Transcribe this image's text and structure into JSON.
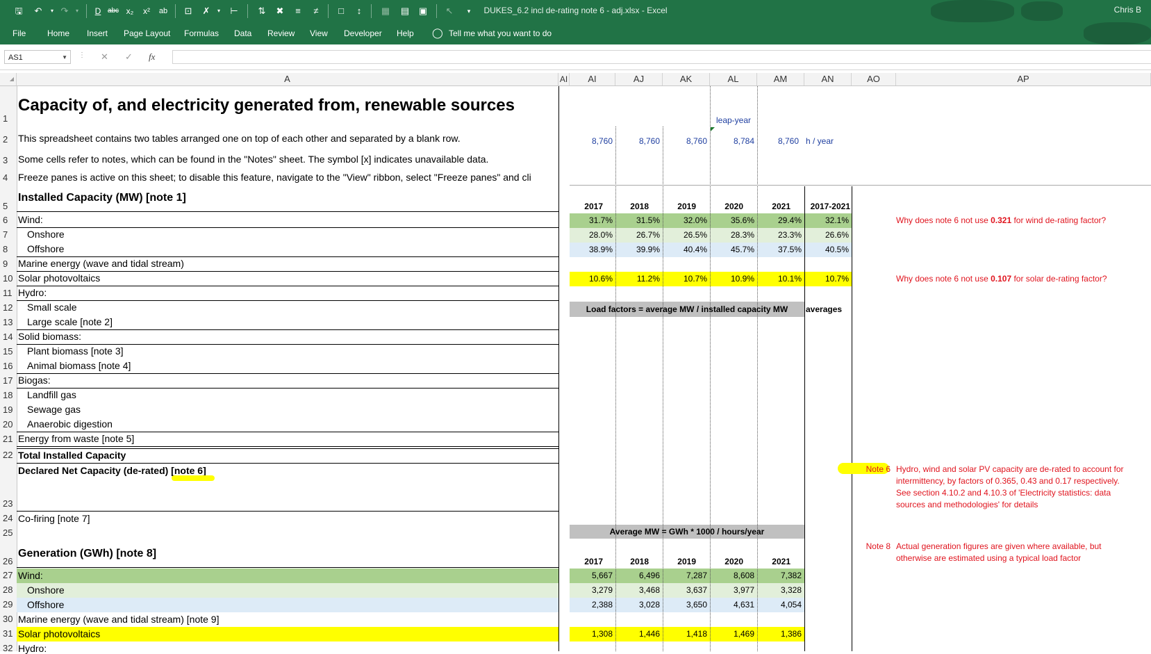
{
  "window": {
    "title": "DUKES_6.2 incl de-rating note 6 - adj.xlsx  -  Excel",
    "user": "Chris B"
  },
  "ribbon": {
    "tabs": [
      "File",
      "Home",
      "Insert",
      "Page Layout",
      "Formulas",
      "Data",
      "Review",
      "View",
      "Developer",
      "Help"
    ],
    "tell_me": "Tell me what you want to do"
  },
  "formula_bar": {
    "name_box": "AS1",
    "fx": "fx",
    "content": ""
  },
  "columns": [
    "A",
    "AI",
    "AI",
    "AJ",
    "AK",
    "AL",
    "AM",
    "AN",
    "AO",
    "AP"
  ],
  "sheet": {
    "title": "Capacity of, and electricity generated from, renewable sources",
    "row2": "This spreadsheet contains two tables arranged one on top of each other and separated by a blank row.",
    "row3": "Some cells refer to notes, which can be found in the \"Notes\" sheet. The symbol [x] indicates unavailable data.",
    "row4": "Freeze panes is active on this sheet; to disable this feature, navigate to the \"View\" ribbon, select \"Freeze panes\" and cli",
    "row5": "Installed Capacity (MW) [note 1]",
    "row6": "Wind:",
    "row7": "Onshore",
    "row8": "Offshore",
    "row9": "Marine energy (wave and tidal stream)",
    "row10": "Solar photovoltaics",
    "row11": "Hydro:",
    "row12": "Small scale",
    "row13": "Large scale [note 2]",
    "row14": "Solid biomass:",
    "row15": "Plant biomass [note 3]",
    "row16": "Animal biomass [note 4]",
    "row17": "Biogas:",
    "row18": "Landfill gas",
    "row19": "Sewage gas",
    "row20": "Anaerobic digestion",
    "row21": "Energy from waste [note 5]",
    "row22": "Total Installed Capacity",
    "row23": "Declared Net Capacity (de-rated) [note 6]",
    "row24": "Co-firing [note 7]",
    "row26": "Generation (GWh) [note 8]",
    "row27": "Wind:",
    "row28": "Onshore",
    "row29": "Offshore",
    "row30": "Marine energy (wave and tidal stream) [note 9]",
    "row31": "Solar photovoltaics",
    "row32": "Hydro:"
  },
  "row_numbers": [
    "1",
    "2",
    "3",
    "4",
    "5",
    "6",
    "7",
    "8",
    "9",
    "10",
    "11",
    "12",
    "13",
    "14",
    "15",
    "16",
    "17",
    "18",
    "19",
    "20",
    "21",
    "22",
    "23",
    "24",
    "25",
    "26",
    "27",
    "28",
    "29",
    "30",
    "31",
    "32"
  ],
  "hours": {
    "leap_label": "leap-year",
    "values": [
      "8,760",
      "8,760",
      "8,760",
      "8,784",
      "8,760"
    ],
    "unit": "h / year"
  },
  "load_factors": {
    "years": [
      "2017",
      "2018",
      "2019",
      "2020",
      "2021",
      "2017-2021"
    ],
    "wind": [
      "31.7%",
      "31.5%",
      "32.0%",
      "35.6%",
      "29.4%",
      "32.1%"
    ],
    "onshore": [
      "28.0%",
      "26.7%",
      "26.5%",
      "28.3%",
      "23.3%",
      "26.6%"
    ],
    "offshore": [
      "38.9%",
      "39.9%",
      "40.4%",
      "45.7%",
      "37.5%",
      "40.5%"
    ],
    "solar": [
      "10.6%",
      "11.2%",
      "10.7%",
      "10.9%",
      "10.1%",
      "10.7%"
    ],
    "formula_label": "Load factors = average MW / installed capacity MW",
    "averages_label": "averages"
  },
  "average_mw": {
    "formula_label": "Average MW = GWh * 1000 / hours/year",
    "years": [
      "2017",
      "2018",
      "2019",
      "2020",
      "2021"
    ],
    "wind": [
      "5,667",
      "6,496",
      "7,287",
      "8,608",
      "7,382"
    ],
    "onshore": [
      "3,279",
      "3,468",
      "3,637",
      "3,977",
      "3,328"
    ],
    "offshore": [
      "2,388",
      "3,028",
      "3,650",
      "4,631",
      "4,054"
    ],
    "solar": [
      "1,308",
      "1,446",
      "1,418",
      "1,469",
      "1,386"
    ]
  },
  "notes": {
    "q_wind_a": "Why does note 6 not use ",
    "q_wind_b": "0.321",
    "q_wind_c": " for wind de-rating factor?",
    "q_solar_a": "Why does note 6 not use ",
    "q_solar_b": "0.107",
    "q_solar_c": " for solar de-rating factor?",
    "note6_label": "Note 6",
    "note6_lines": [
      "Hydro, wind and solar PV capacity are de-rated to account for",
      "intermittency, by factors of 0.365, 0.43 and 0.17 respectively.",
      "See section 4.10.2 and 4.10.3 of 'Electricity statistics: data",
      "sources and methodologies' for details"
    ],
    "note8_label": "Note 8",
    "note8_lines": [
      "Actual generation figures are given where available, but",
      "otherwise are estimated using a typical load factor"
    ]
  },
  "colors": {
    "excel_green": "#217346",
    "green_band": "#a9d08e",
    "light_green": "#e2efda",
    "light_blue": "#ddebf7",
    "yellow": "#ffff00",
    "gray_label": "#c0c0c0",
    "note_red": "#e0141e",
    "value_blue": "#1f3fa0"
  }
}
